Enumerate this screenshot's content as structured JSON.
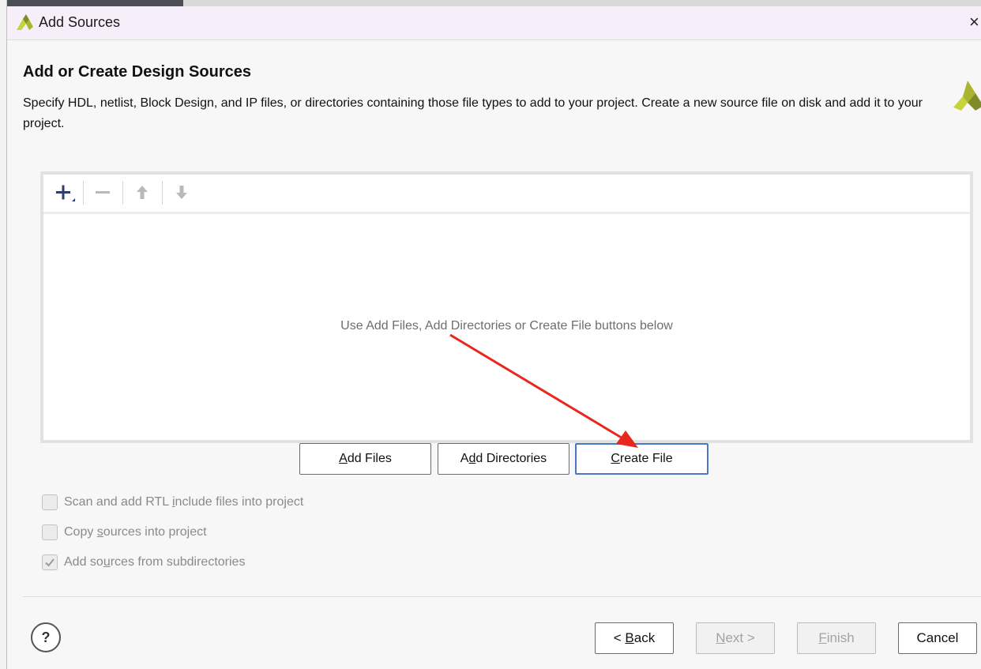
{
  "dialog": {
    "title": "Add Sources",
    "close_glyph": "×"
  },
  "header": {
    "title": "Add or Create Design Sources",
    "description": "Specify HDL, netlist, Block Design, and IP files, or directories containing those file types to add to your project. Create a new source file on disk and add it to your project."
  },
  "sources_panel": {
    "toolbar": [
      "add-icon",
      "remove-icon",
      "move-up-icon",
      "move-down-icon"
    ],
    "empty_message": "Use Add Files, Add Directories or Create File buttons below"
  },
  "actions": {
    "add_files": {
      "pre": "",
      "key": "A",
      "post": "dd Files"
    },
    "add_directories": {
      "pre": "A",
      "key": "d",
      "post": "d Directories"
    },
    "create_file": {
      "pre": "",
      "key": "C",
      "post": "reate File"
    }
  },
  "options": [
    {
      "label": "Scan and add RTL include files into project",
      "checked": false,
      "pre": "Scan and add RTL ",
      "key": "i",
      "post": "nclude files into project"
    },
    {
      "label": "Copy sources into project",
      "checked": false,
      "pre": "Copy ",
      "key": "s",
      "post": "ources into project"
    },
    {
      "label": "Add sources from subdirectories",
      "checked": true,
      "pre": "Add so",
      "key": "u",
      "post": "rces from subdirectories"
    }
  ],
  "footer": {
    "help": "?",
    "back": {
      "pre": "< ",
      "key": "B",
      "post": "ack",
      "enabled": true
    },
    "next": {
      "pre": "",
      "key": "N",
      "post": "ext >",
      "enabled": false
    },
    "finish": {
      "pre": "",
      "key": "F",
      "post": "inish",
      "enabled": false
    },
    "cancel": "Cancel"
  },
  "colors": {
    "accent_focus": "#4a78c4",
    "annotation_arrow": "#e8281e",
    "logo_yellow": "#c8d23a",
    "logo_olive": "#7f8a28"
  }
}
